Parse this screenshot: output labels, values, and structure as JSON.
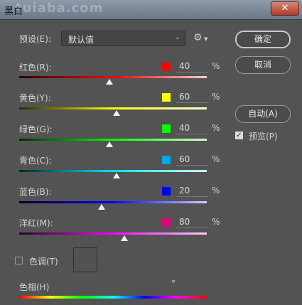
{
  "window": {
    "title": "黑白",
    "watermark": "tuiaba.com",
    "close_label": "✕"
  },
  "preset": {
    "label": "预设(E):",
    "value": "默认值"
  },
  "buttons": {
    "ok": "确定",
    "cancel": "取消",
    "auto": "自动(A)"
  },
  "preview": {
    "label": "预览(P)",
    "checked": true
  },
  "channels": [
    {
      "label": "红色(R):",
      "value": "40",
      "unit": "%",
      "color": "#ff0000",
      "fraction": 0.48
    },
    {
      "label": "黄色(Y):",
      "value": "60",
      "unit": "%",
      "color": "#ffff00",
      "fraction": 0.52
    },
    {
      "label": "绿色(G):",
      "value": "40",
      "unit": "%",
      "color": "#00ff00",
      "fraction": 0.48
    },
    {
      "label": "青色(C):",
      "value": "60",
      "unit": "%",
      "color": "#00a8e0",
      "fraction": 0.52
    },
    {
      "label": "蓝色(B):",
      "value": "20",
      "unit": "%",
      "color": "#0000ff",
      "fraction": 0.44
    },
    {
      "label": "洋红(M):",
      "value": "80",
      "unit": "%",
      "color": "#e0007a",
      "fraction": 0.56
    }
  ],
  "tint": {
    "label": "色调(T)",
    "checked": false
  },
  "hue": {
    "label": "色相(H)",
    "unit": "°"
  }
}
